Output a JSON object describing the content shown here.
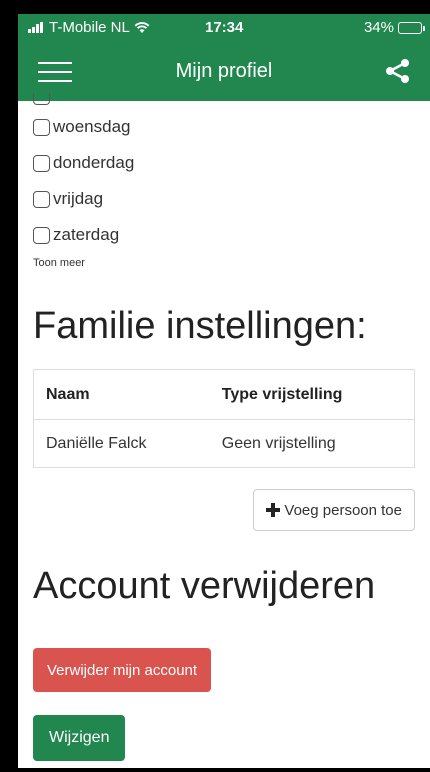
{
  "status_bar": {
    "carrier": "T-Mobile NL",
    "time": "17:34",
    "battery_percent": "34%",
    "battery_level": 0.34
  },
  "navbar": {
    "title": "Mijn profiel",
    "menu_icon": "hamburger-icon",
    "share_icon": "share-icon"
  },
  "days": [
    {
      "label": "woensdag",
      "checked": false
    },
    {
      "label": "donderdag",
      "checked": false
    },
    {
      "label": "vrijdag",
      "checked": false
    },
    {
      "label": "zaterdag",
      "checked": false
    }
  ],
  "show_more_label": "Toon meer",
  "family": {
    "title": "Familie instellingen:",
    "columns": [
      "Naam",
      "Type vrijstelling"
    ],
    "rows": [
      [
        "Daniëlle Falck",
        "Geen vrijstelling"
      ]
    ],
    "add_button_label": "Voeg persoon toe"
  },
  "account": {
    "title": "Account verwijderen",
    "delete_button_label": "Verwijder mijn account",
    "edit_button_label": "Wijzigen"
  },
  "colors": {
    "header_green": "#21874f",
    "danger_red": "#d9534f",
    "button_green": "#21874f"
  }
}
